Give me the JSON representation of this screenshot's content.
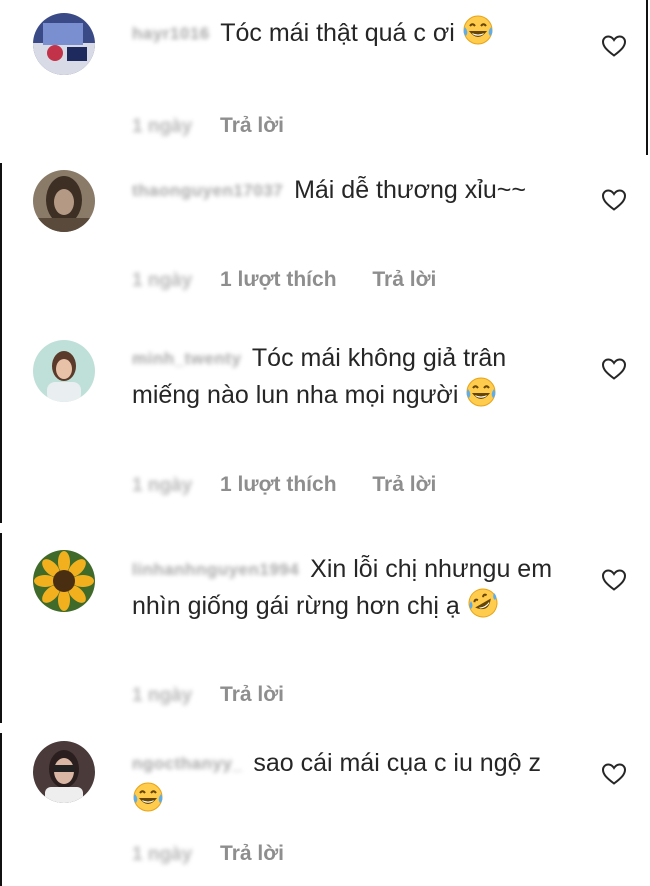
{
  "comments": [
    {
      "username": "hayr1016",
      "text": "Tóc mái thật quá c ơi",
      "emoji_name": "tears-of-joy",
      "time": "1 ngày",
      "likes": "",
      "reply_label": "Trả lời"
    },
    {
      "username": "thaonguyen17037",
      "text": "Mái dễ thương xỉu~~",
      "emoji_name": "",
      "time": "1 ngày",
      "likes": "1 lượt thích",
      "reply_label": "Trả lời"
    },
    {
      "username": "minh_twenty",
      "text": "Tóc mái không giả trân miếng nào lun nha mọi người",
      "emoji_name": "tears-of-joy",
      "time": "1 ngày",
      "likes": "1 lượt thích",
      "reply_label": "Trả lời"
    },
    {
      "username": "linhanhnguyen1994",
      "text": "Xin lỗi chị nhưngu em nhìn giống gái rừng hơn chị ạ",
      "emoji_name": "rolling-on-floor-laughing",
      "time": "1 ngày",
      "likes": "",
      "reply_label": "Trả lời"
    },
    {
      "username": "ngocthanyy_",
      "text": "sao cái mái cụa c iu ngộ z",
      "emoji_name": "tears-of-joy",
      "time": "1 ngày",
      "likes": "",
      "reply_label": "Trả lời"
    }
  ],
  "icons": {
    "like": "heart-outline-icon",
    "emoji_laugh": "face-with-tears-of-joy-emoji",
    "emoji_rofl": "rolling-on-floor-laughing-emoji"
  },
  "colors": {
    "text": "#262626",
    "meta": "#8e8e8e",
    "background": "#ffffff"
  }
}
